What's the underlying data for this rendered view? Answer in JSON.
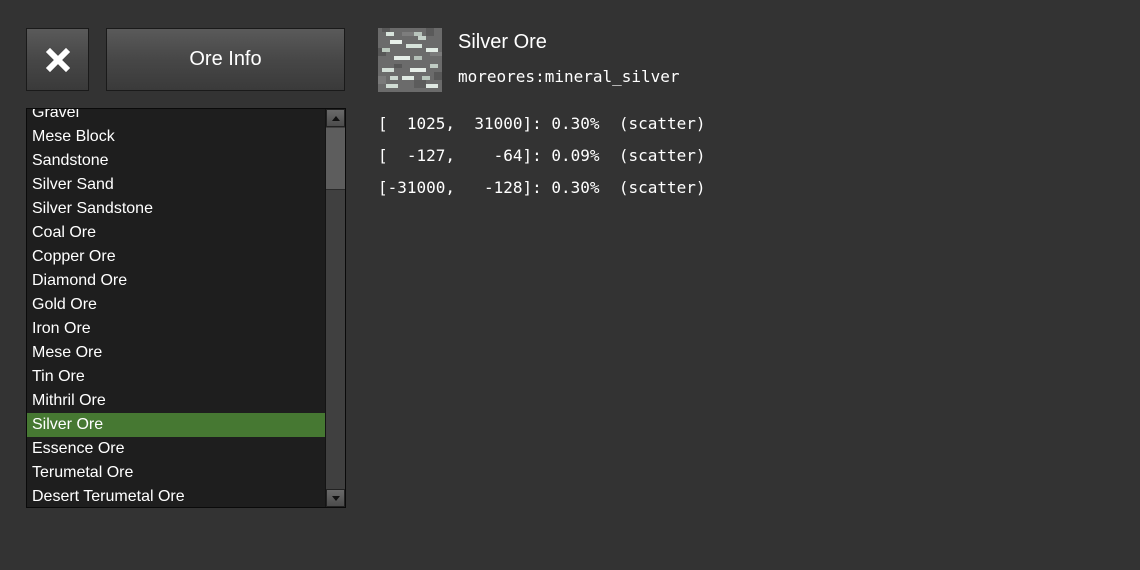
{
  "toolbar": {
    "close_icon": "close-x-icon",
    "title_button_label": "Ore Info"
  },
  "ore_list": {
    "items": [
      "Gravel",
      "Mese Block",
      "Sandstone",
      "Silver Sand",
      "Silver Sandstone",
      "Coal Ore",
      "Copper Ore",
      "Diamond Ore",
      "Gold Ore",
      "Iron Ore",
      "Mese Ore",
      "Tin Ore",
      "Mithril Ore",
      "Silver Ore",
      "Essence Ore",
      "Terumetal Ore",
      "Desert Terumetal Ore"
    ],
    "selected_item": "Silver Ore",
    "selected_color": "#467832"
  },
  "detail": {
    "icon": "silver-ore-texture-icon",
    "name": "Silver Ore",
    "id": "moreores:mineral_silver",
    "ranges": [
      "[  1025,  31000]: 0.30%  (scatter)",
      "[  -127,    -64]: 0.09%  (scatter)",
      "[-31000,   -128]: 0.30%  (scatter)"
    ]
  },
  "colors": {
    "background": "#333333",
    "list_background": "#1e1e1e",
    "text": "#ffffff"
  }
}
